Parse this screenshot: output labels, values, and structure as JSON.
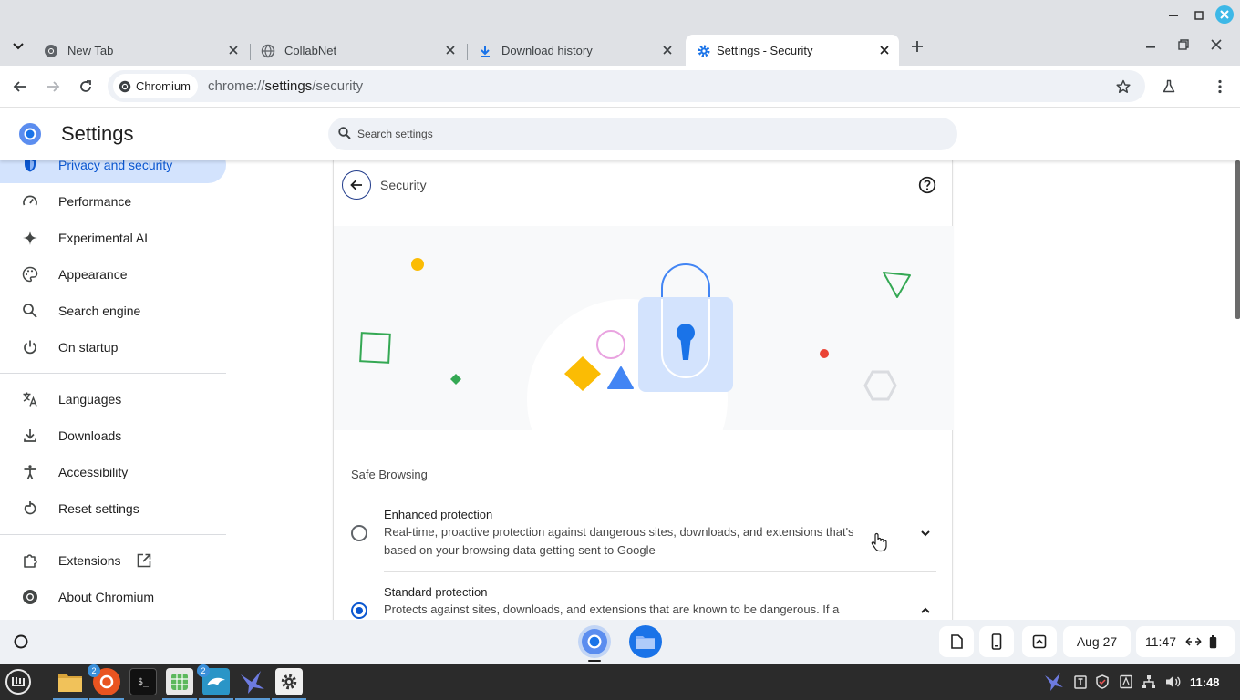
{
  "browser": {
    "tabs": [
      {
        "title": "New Tab",
        "icon": "chrome-icon",
        "active": false
      },
      {
        "title": "CollabNet",
        "icon": "globe-icon",
        "active": false
      },
      {
        "title": "Download history",
        "icon": "download-icon",
        "active": false
      },
      {
        "title": "Settings - Security",
        "icon": "gear-icon",
        "active": true
      }
    ],
    "site_chip": "Chromium",
    "url_prefix": "chrome://",
    "url_host": "settings",
    "url_path": "/security"
  },
  "settings": {
    "title": "Settings",
    "search_placeholder": "Search settings",
    "nav": [
      {
        "label": "Privacy and security",
        "icon": "shield-icon",
        "selected": true
      },
      {
        "label": "Performance",
        "icon": "speedometer-icon"
      },
      {
        "label": "Experimental AI",
        "icon": "sparkle-icon"
      },
      {
        "label": "Appearance",
        "icon": "palette-icon"
      },
      {
        "label": "Search engine",
        "icon": "search-icon"
      },
      {
        "label": "On startup",
        "icon": "power-icon"
      },
      {
        "label": "Languages",
        "icon": "translate-icon"
      },
      {
        "label": "Downloads",
        "icon": "download-icon"
      },
      {
        "label": "Accessibility",
        "icon": "accessibility-icon"
      },
      {
        "label": "Reset settings",
        "icon": "reset-icon"
      },
      {
        "label": "Extensions",
        "icon": "puzzle-icon"
      },
      {
        "label": "About Chromium",
        "icon": "chromium-icon"
      }
    ]
  },
  "security_page": {
    "title": "Security",
    "section_heading": "Safe Browsing",
    "options": [
      {
        "title": "Enhanced protection",
        "description": "Real-time, proactive protection against dangerous sites, downloads, and extensions that's based on your browsing data getting sent to Google",
        "selected": false
      },
      {
        "title": "Standard protection",
        "description": "Protects against sites, downloads, and extensions that are known to be dangerous. If a page",
        "selected": true
      }
    ]
  },
  "shelf": {
    "date": "Aug 27",
    "time": "11:47"
  },
  "taskbar": {
    "clock": "11:48",
    "badges": [
      "2",
      "2"
    ]
  },
  "colors": {
    "accent": "#0b57d0",
    "nav_selected_bg": "#d3e3fd",
    "tabstrip_bg": "#dfe1e5"
  }
}
